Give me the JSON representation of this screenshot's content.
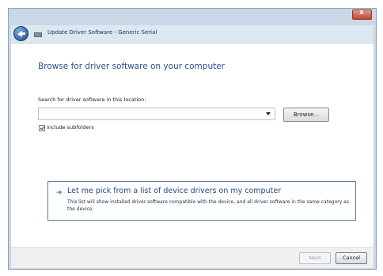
{
  "window": {
    "title": "Update Driver Software - Generic Serial",
    "close_icon": "close-icon",
    "back_icon": "back-arrow-icon"
  },
  "main": {
    "heading": "Browse for driver software on your computer",
    "search_label": "Search for driver software in this location:",
    "path_value": "",
    "browse_label": "Browse...",
    "include_subfolders_label": "Include subfolders",
    "include_subfolders_checked": true
  },
  "pick_option": {
    "title": "Let me pick from a list of device drivers on my computer",
    "description": "This list will show installed driver software compatible with the device, and all driver software in the same category as the device."
  },
  "footer": {
    "next_label": "Next",
    "cancel_label": "Cancel"
  },
  "colors": {
    "heading": "#2b4f8c",
    "link": "#1f4a8e",
    "accent_arrow": "#2c9e48",
    "chrome": "#c9d8e6"
  }
}
